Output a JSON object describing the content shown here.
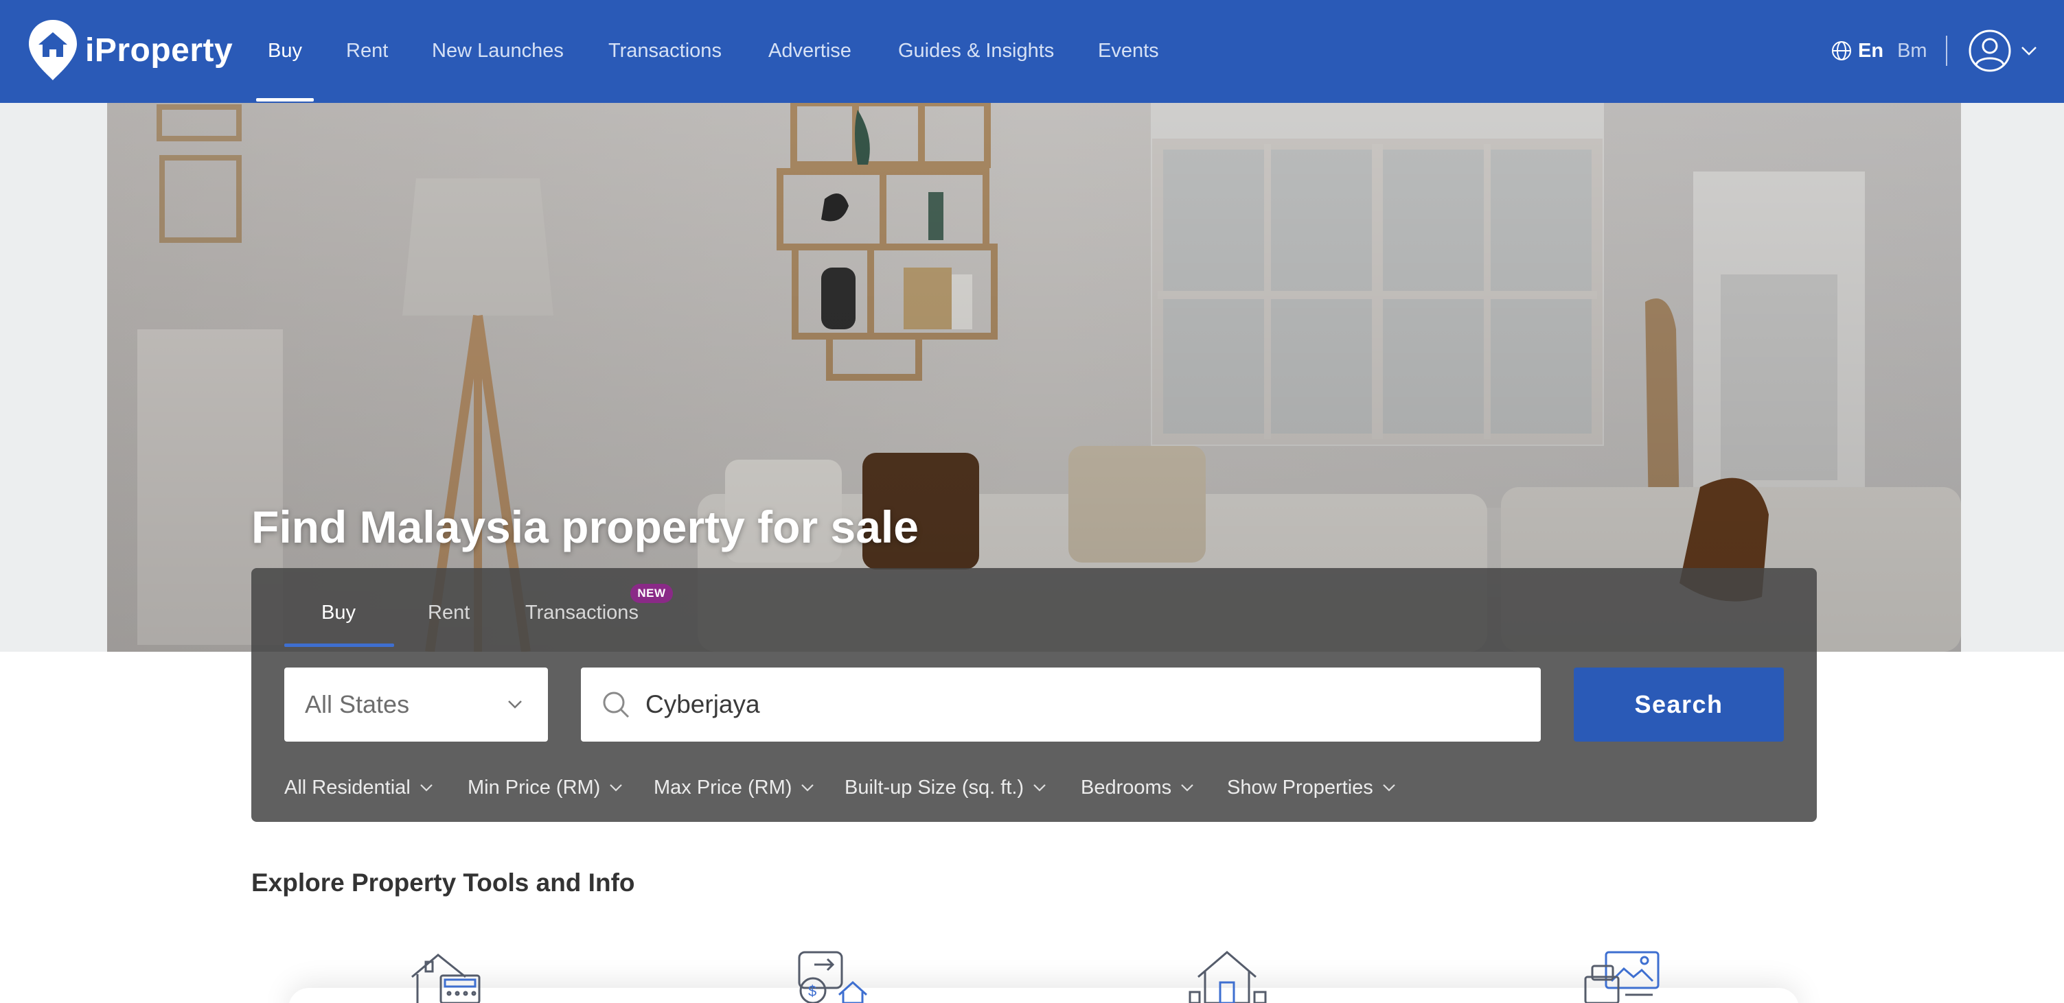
{
  "brand": {
    "name": "iProperty"
  },
  "nav": {
    "items": [
      {
        "label": "Buy",
        "active": true
      },
      {
        "label": "Rent"
      },
      {
        "label": "New Launches"
      },
      {
        "label": "Transactions"
      },
      {
        "label": "Advertise"
      },
      {
        "label": "Guides & Insights"
      },
      {
        "label": "Events"
      }
    ],
    "lang_en": "En",
    "lang_bm": "Bm"
  },
  "hero": {
    "title": "Find Malaysia property for sale"
  },
  "search_panel": {
    "tabs": [
      {
        "label": "Buy",
        "active": true
      },
      {
        "label": "Rent"
      },
      {
        "label": "Transactions",
        "badge": "NEW"
      }
    ],
    "state_select": {
      "value": "All States"
    },
    "search": {
      "value": "Cyberjaya"
    },
    "search_button": "Search",
    "filters": [
      "All Residential",
      "Min Price (RM)",
      "Max Price (RM)",
      "Built-up Size (sq. ft.)",
      "Bedrooms",
      "Show Properties"
    ]
  },
  "explore": {
    "title": "Explore Property Tools and Info"
  },
  "colors": {
    "brand_blue": "#2a5ab7",
    "badge_purple": "#8a2a87",
    "panel_overlay": "#464646"
  },
  "icons": {
    "tools": [
      "house-calculator-icon",
      "money-transfer-house-icon",
      "house-value-icon",
      "property-listing-icon"
    ]
  }
}
